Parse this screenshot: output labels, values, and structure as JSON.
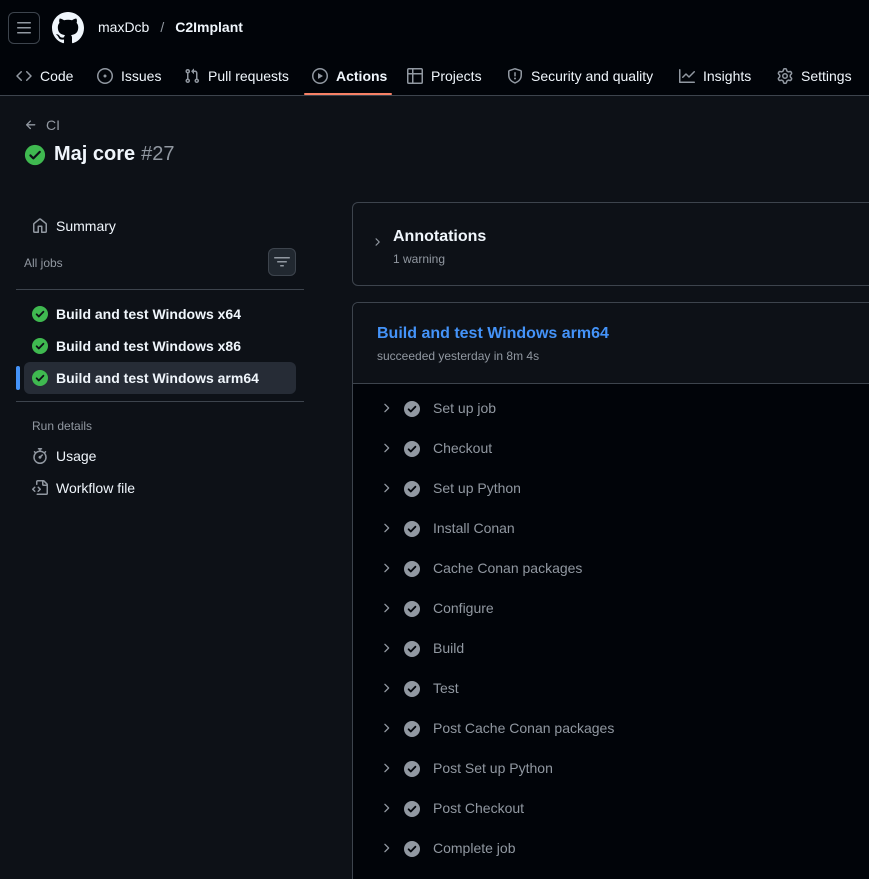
{
  "header": {
    "owner": "maxDcb",
    "separator": "/",
    "repo": "C2Implant",
    "tabs": [
      {
        "label": "Code",
        "icon": "code-icon"
      },
      {
        "label": "Issues",
        "icon": "issue-opened-icon"
      },
      {
        "label": "Pull requests",
        "icon": "git-pull-request-icon"
      },
      {
        "label": "Actions",
        "icon": "play-icon",
        "active": true
      },
      {
        "label": "Projects",
        "icon": "table-icon"
      },
      {
        "label": "Security and quality",
        "icon": "shield-icon"
      },
      {
        "label": "Insights",
        "icon": "graph-icon"
      },
      {
        "label": "Settings",
        "icon": "gear-icon"
      }
    ]
  },
  "run": {
    "back_label": "CI",
    "title": "Maj core",
    "number": "#27"
  },
  "sidebar": {
    "summary_label": "Summary",
    "all_jobs_label": "All jobs",
    "jobs": [
      {
        "label": "Build and test Windows x64"
      },
      {
        "label": "Build and test Windows x86"
      },
      {
        "label": "Build and test Windows arm64",
        "selected": true
      }
    ],
    "run_details_label": "Run details",
    "usage_label": "Usage",
    "workflow_file_label": "Workflow file"
  },
  "annotations": {
    "title": "Annotations",
    "subtitle": "1 warning"
  },
  "job": {
    "title": "Build and test Windows arm64",
    "status": "succeeded yesterday in 8m 4s",
    "steps": [
      "Set up job",
      "Checkout",
      "Set up Python",
      "Install Conan",
      "Cache Conan packages",
      "Configure",
      "Build",
      "Test",
      "Post Cache Conan packages",
      "Post Set up Python",
      "Post Checkout",
      "Complete job"
    ]
  },
  "colors": {
    "success": "#3fb950",
    "accent": "#4493f8",
    "tab_underline": "#f78166",
    "muted": "#9198a1"
  }
}
